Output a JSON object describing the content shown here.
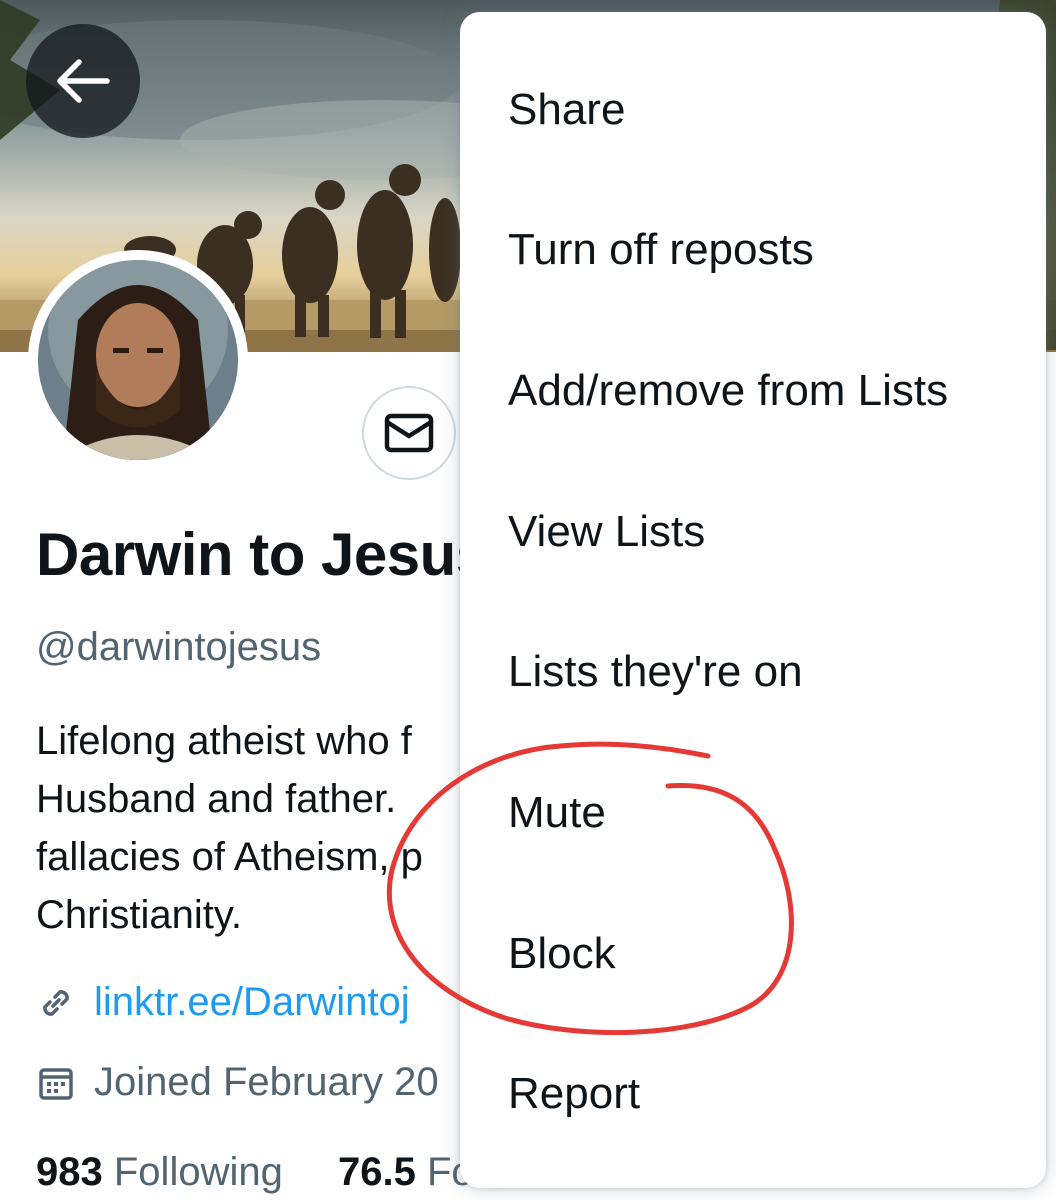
{
  "profile": {
    "name": "Darwin to Jesus",
    "handle": "@darwintojesus",
    "bio_lines": [
      "Lifelong atheist who f",
      "Husband and father.",
      "fallacies of Atheism, p",
      "Christianity."
    ],
    "link": "linktr.ee/Darwintoj",
    "joined": "Joined February 20",
    "following_count": "983",
    "following_label": "Following",
    "followers_count": "76.5",
    "followers_label": "Followers"
  },
  "icons": {
    "back": "arrow-left-icon",
    "message": "envelope-icon",
    "link": "link-icon",
    "calendar": "calendar-icon"
  },
  "menu": {
    "items": [
      "Share",
      "Turn off reposts",
      "Add/remove from Lists",
      "View Lists",
      "Lists they're on",
      "Mute",
      "Block",
      "Report"
    ]
  },
  "colors": {
    "link": "#1d9bf0",
    "secondary_text": "#536471",
    "annotation": "#e53935"
  }
}
